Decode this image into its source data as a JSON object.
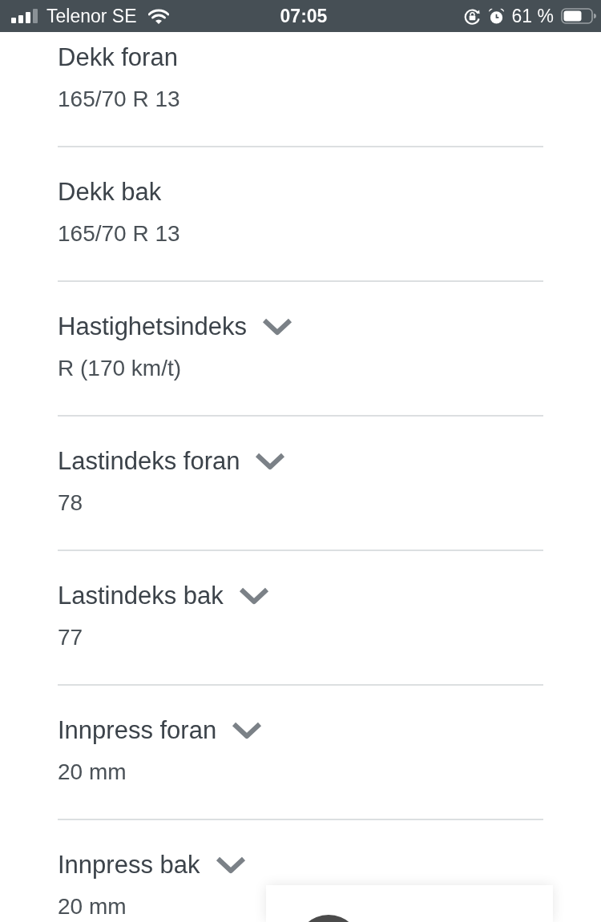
{
  "status_bar": {
    "carrier": "Telenor SE",
    "time": "07:05",
    "battery_text": "61 %"
  },
  "fields": [
    {
      "label": "Dekk foran",
      "value": "165/70 R 13",
      "expandable": false
    },
    {
      "label": "Dekk bak",
      "value": "165/70 R 13",
      "expandable": false
    },
    {
      "label": "Hastighetsindeks",
      "value": "R (170 km/t)",
      "expandable": true
    },
    {
      "label": "Lastindeks foran",
      "value": "78",
      "expandable": true
    },
    {
      "label": "Lastindeks bak",
      "value": "77",
      "expandable": true
    },
    {
      "label": "Innpress foran",
      "value": "20 mm",
      "expandable": true
    },
    {
      "label": "Innpress bak",
      "value": "20 mm",
      "expandable": true
    }
  ]
}
